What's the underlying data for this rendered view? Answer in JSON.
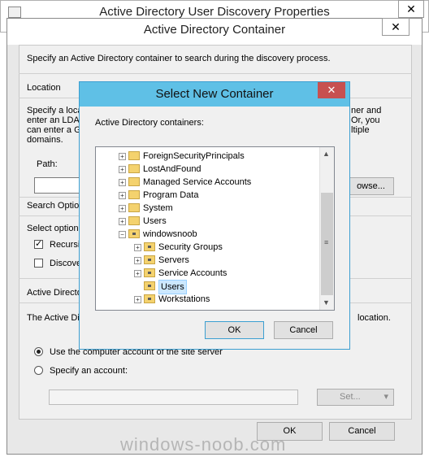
{
  "back_window": {
    "title": "Active Directory User Discovery Properties",
    "close": "✕"
  },
  "container_dialog": {
    "title": "Active Directory Container",
    "close": "✕",
    "intro": "Specify an Active Directory container to search during the discovery process.",
    "location_label": "Location",
    "location_desc": [
      "Specify a loca",
      "enter an LDA",
      "can enter a G",
      "domains."
    ],
    "location_desc_right": [
      "ner and",
      "Or, you",
      "ltiple"
    ],
    "path_label": "Path:",
    "path_value": "",
    "browse_button": "owse...",
    "search_options_label": "Search Optio",
    "select_options_label": "Select options",
    "recursive_label": "Recursi",
    "recursive_checked": true,
    "discover_label": "Discove",
    "discover_checked": false,
    "ad_account_label": "Active Directo",
    "ad_account_desc_left": "The Active Di",
    "ad_account_desc_right": "location.",
    "radio_computer_label": "Use the computer account of the site server",
    "radio_specify_label": "Specify an account:",
    "account_value": "",
    "set_button": "Set...",
    "ok_button": "OK",
    "cancel_button": "Cancel"
  },
  "select_dialog": {
    "title": "Select New Container",
    "close": "✕",
    "containers_label": "Active Directory containers:",
    "tree": [
      {
        "label": "ForeignSecurityPrincipals",
        "level": 0,
        "expander": "+",
        "icon": "folder-icon"
      },
      {
        "label": "LostAndFound",
        "level": 0,
        "expander": "+",
        "icon": "folder-icon"
      },
      {
        "label": "Managed Service Accounts",
        "level": 0,
        "expander": "+",
        "icon": "folder-icon"
      },
      {
        "label": "Program Data",
        "level": 0,
        "expander": "+",
        "icon": "folder-icon"
      },
      {
        "label": "System",
        "level": 0,
        "expander": "+",
        "icon": "folder-icon"
      },
      {
        "label": "Users",
        "level": 0,
        "expander": "+",
        "icon": "folder-icon"
      },
      {
        "label": "windowsnoob",
        "level": 0,
        "expander": "−",
        "icon": "ou-icon"
      },
      {
        "label": "Security Groups",
        "level": 1,
        "expander": "+",
        "icon": "ou-icon"
      },
      {
        "label": "Servers",
        "level": 1,
        "expander": "+",
        "icon": "ou-icon"
      },
      {
        "label": "Service Accounts",
        "level": 1,
        "expander": "+",
        "icon": "ou-icon"
      },
      {
        "label": "Users",
        "level": 1,
        "expander": "",
        "icon": "ou-icon",
        "selected": true
      },
      {
        "label": "Workstations",
        "level": 1,
        "expander": "+",
        "icon": "ou-icon"
      }
    ],
    "ok_button": "OK",
    "cancel_button": "Cancel"
  },
  "watermark": "windows-noob.com",
  "colors": {
    "title_accent": "#5fc0e6",
    "close_red": "#c75050",
    "selection": "#cce8ff"
  }
}
